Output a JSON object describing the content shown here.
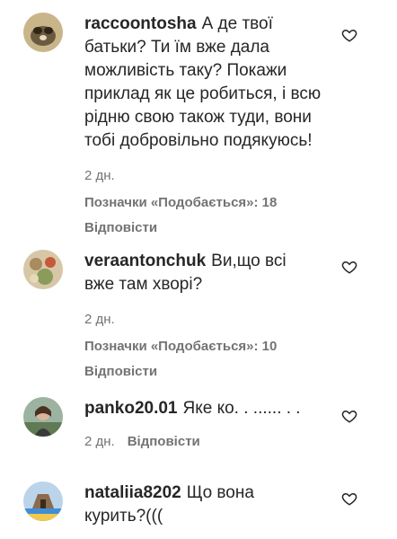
{
  "comments": [
    {
      "username": "raccoontosha",
      "lines": [
        "А де твої",
        "батьки? Ти їм вже дала",
        "можливість таку? Покажи",
        "приклад як це робиться, і всю",
        "рідню свою також туди, вони",
        "тобі добровільно подякуюсь!"
      ],
      "time": "2 дн.",
      "likes": "Позначки «Подобається»: 18",
      "reply": "Відповісти",
      "avatar_icon": "raccoon-avatar-icon",
      "like_icon": "heart-outline-icon"
    },
    {
      "username": "veraantonchuk",
      "lines": [
        "Ви,що всі",
        "вже там хворі?"
      ],
      "time": "2 дн.",
      "likes": "Позначки «Подобається»: 10",
      "reply": "Відповісти",
      "avatar_icon": "user-avatar-icon",
      "like_icon": "heart-outline-icon"
    },
    {
      "username": "panko20.01",
      "lines": [
        "Яке ко. . ...... . ."
      ],
      "time": "2 дн.",
      "reply": "Відповісти",
      "avatar_icon": "user-avatar-icon",
      "like_icon": "heart-outline-icon"
    },
    {
      "username": "nataliia8202",
      "lines": [
        "Що вона",
        "курить?((("
      ],
      "avatar_icon": "user-avatar-icon",
      "like_icon": "heart-outline-icon"
    }
  ],
  "colors": {
    "text": "#262626",
    "secondary": "#737373",
    "background": "#ffffff"
  }
}
